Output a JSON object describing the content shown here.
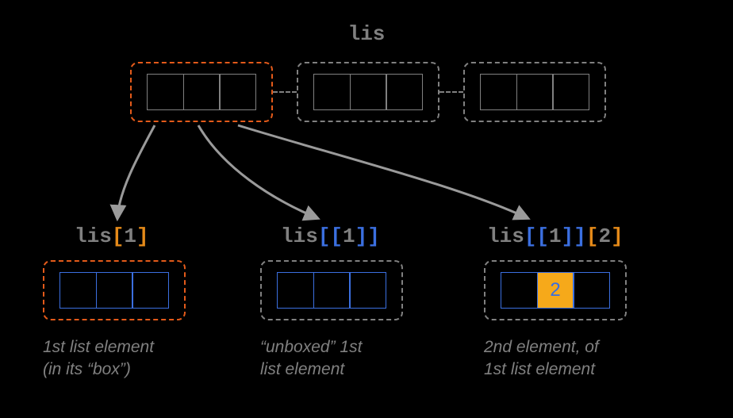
{
  "title": "lis",
  "sub1": {
    "pre": "lis",
    "b1": "[",
    "n": "1",
    "b2": "]"
  },
  "sub2": {
    "pre": "lis",
    "b1": "[[",
    "n": "1",
    "b2": "]]"
  },
  "sub3": {
    "pre": "lis",
    "b1": "[[",
    "n1": "1",
    "b2": "]]",
    "b3": "[",
    "n2": "2",
    "b4": "]"
  },
  "cap1a": "1st list element",
  "cap1b": "(in its “box”)",
  "cap2a": "“unboxed” 1st",
  "cap2b": "list element",
  "cap3a": "2nd element, of",
  "cap3b": "1st list element",
  "highlight_value": "2"
}
